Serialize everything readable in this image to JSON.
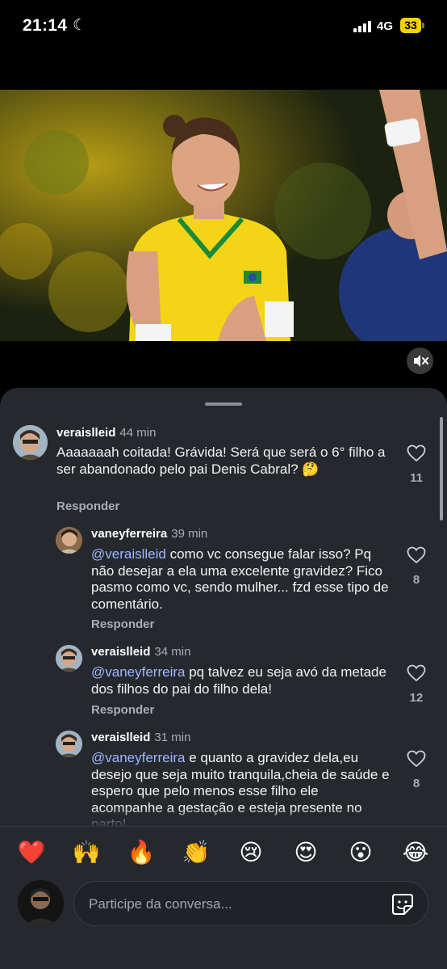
{
  "status_bar": {
    "time": "21:14",
    "network": "4G",
    "battery": "33"
  },
  "comments": [
    {
      "username": "veraislleid",
      "time": "44 min",
      "mention": "",
      "text": "Aaaaaaah coitada! Grávida! Será que será o 6° filho a ser abandonado pelo pai Denis Cabral? 🤔",
      "reply_label": "Responder",
      "likes": "11"
    },
    {
      "username": "vaneyferreira",
      "time": "39 min",
      "mention": "@veraislleid",
      "text": " como vc consegue falar isso? Pq não desejar a ela uma excelente gravidez? Fico pasmo como vc, sendo mulher... fzd esse tipo de comentário.",
      "reply_label": "Responder",
      "likes": "8"
    },
    {
      "username": "veraislleid",
      "time": "34 min",
      "mention": "@vaneyferreira",
      "text": " pq talvez eu seja avó da metade dos filhos do pai do filho dela!",
      "reply_label": "Responder",
      "likes": "12"
    },
    {
      "username": "veraislleid",
      "time": "31 min",
      "mention": "@vaneyferreira",
      "text": " e quanto a gravidez dela,eu desejo que seja muito tranquila,cheia de saúde e espero que pelo menos esse filho ele acompanhe a gestação e esteja presente no parto!",
      "reply_label": "",
      "likes": "8"
    }
  ],
  "reactions": [
    "❤️",
    "🙌",
    "🔥",
    "👏",
    "😢",
    "😍",
    "😮",
    "😂"
  ],
  "composer": {
    "placeholder": "Participe da conversa..."
  },
  "icons": {
    "mute": "speaker-muted-icon",
    "like": "heart-outline-icon",
    "sticker": "sticker-icon",
    "moon": "moon-icon"
  }
}
